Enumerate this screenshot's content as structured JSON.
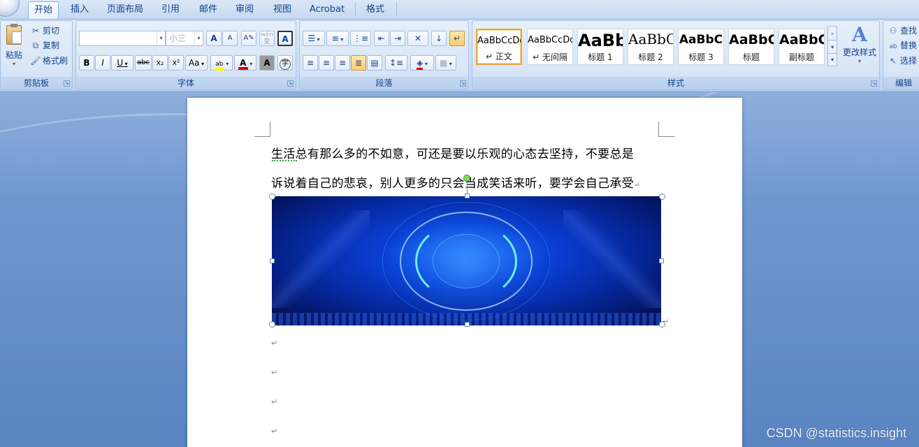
{
  "tabs": [
    "开始",
    "插入",
    "页面布局",
    "引用",
    "邮件",
    "审阅",
    "视图",
    "Acrobat",
    "格式"
  ],
  "active_tab": "开始",
  "clipboard": {
    "paste": "粘贴",
    "cut": "剪切",
    "copy": "复制",
    "format_painter": "格式刷",
    "label": "剪贴板"
  },
  "font": {
    "name_value": "",
    "size_value": "小三",
    "label": "字体",
    "grow": "A",
    "shrink": "A",
    "bold": "B",
    "italic": "I",
    "underline": "U",
    "strike": "abc",
    "subscript": "x₂",
    "superscript": "x²",
    "case": "Aa",
    "wen": "wén",
    "bian": "变",
    "border_a": "A",
    "shade_a": "A",
    "enclose": "字"
  },
  "paragraph": {
    "label": "段落"
  },
  "styles": {
    "label": "样式",
    "items": [
      {
        "sample": "AaBbCcDd",
        "name": "↵ 正文"
      },
      {
        "sample": "AaBbCcDd",
        "name": "↵ 无间隔"
      },
      {
        "sample": "AaBb",
        "name": "标题 1"
      },
      {
        "sample": "AaBbC",
        "name": "标题 2"
      },
      {
        "sample": "AaBbC",
        "name": "标题 3"
      },
      {
        "sample": "AaBbC",
        "name": "标题"
      },
      {
        "sample": "AaBbC",
        "name": "副标题"
      }
    ],
    "change": "更改样式"
  },
  "editing": {
    "find": "查找",
    "replace": "替换",
    "select": "选择",
    "label": "编辑"
  },
  "document": {
    "line1": "生活总有那么多的不如意，可还是要以乐观的心态去坚持，不要总是",
    "line2": "诉说着自己的悲哀，别人更多的只会当成笑话来听，要学会自己承受",
    "para_mark": "↵"
  },
  "watermark": "CSDN @statistics.insight"
}
